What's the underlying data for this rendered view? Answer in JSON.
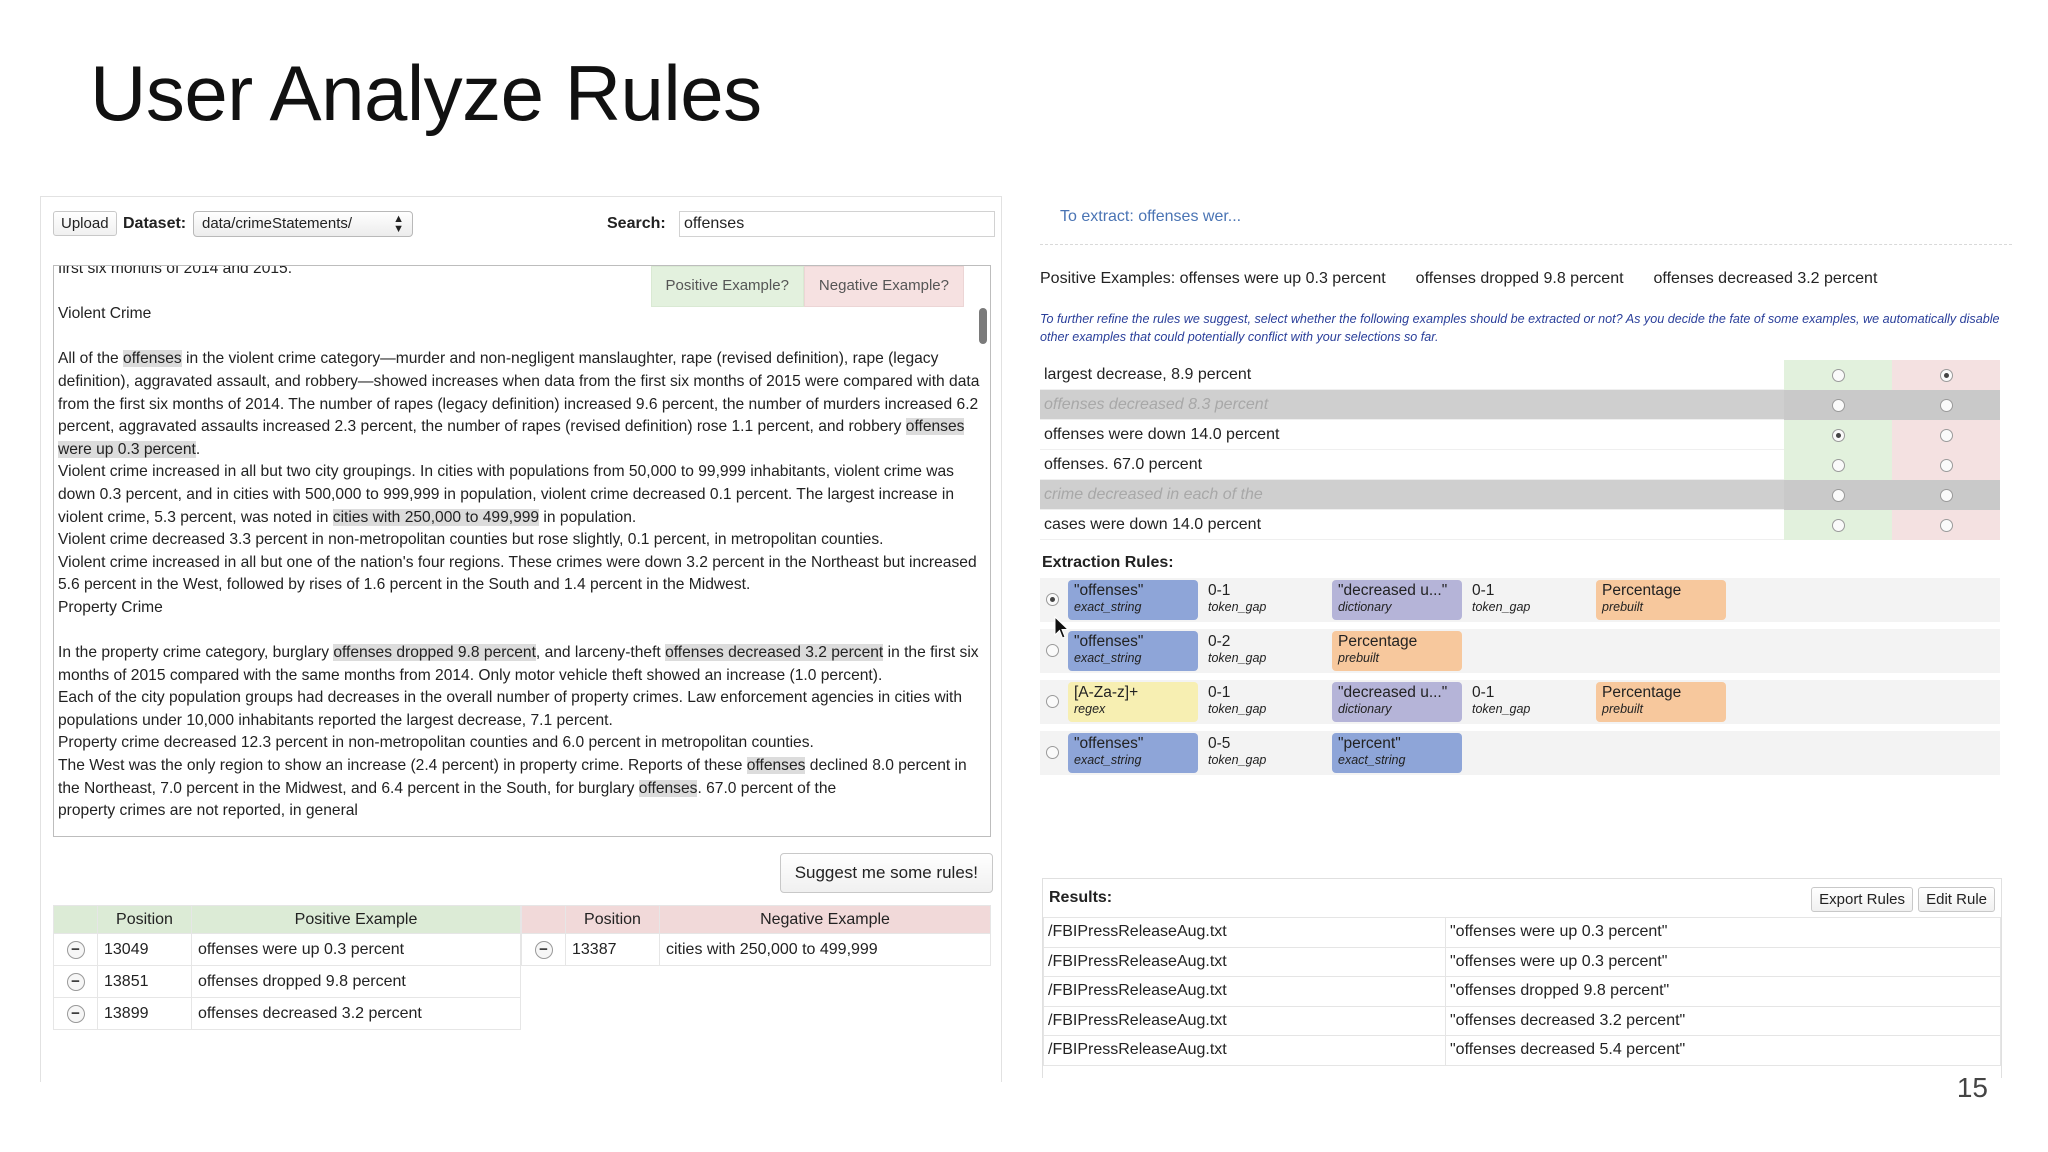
{
  "slide": {
    "title": "User Analyze Rules",
    "page_number": "15"
  },
  "left": {
    "toolbar": {
      "upload_label": "Upload",
      "dataset_label": "Dataset:",
      "dataset_value": "data/crimeStatements/",
      "search_label": "Search:",
      "search_value": "offenses"
    },
    "example_tabs": {
      "positive": "Positive Example?",
      "negative": "Negative Example?"
    },
    "text": {
      "l0": "first six months of 2014 and 2015.",
      "heading1": "Violent Crime",
      "p1_a": "All of the ",
      "p1_h1": "offenses",
      "p1_b": " in the violent crime category—murder and non-negligent manslaughter, rape (revised definition), rape (legacy definition), aggravated assault, and robbery—showed increases when data from the first six months of 2015 were compared with data from the first six months of 2014. The number of rapes (legacy definition) increased 9.6 percent, the number of murders increased 6.2 percent, aggravated assaults increased 2.3 percent, the number of rapes (revised definition) rose 1.1 percent, and robbery ",
      "p1_h2": "offenses were up 0.3 percent",
      "p1_c": ".",
      "p2_a": "Violent crime increased in all but two city groupings. In cities with populations from 50,000 to 99,999 inhabitants, violent crime was down 0.3 percent, and in cities with 500,000 to 999,999 in population, violent crime decreased 0.1 percent. The largest increase in violent crime, 5.3 percent, was noted in ",
      "p2_h": "cities with 250,000 to 499,999",
      "p2_b": " in population.",
      "p3": "Violent crime decreased 3.3 percent in non-metropolitan counties but rose slightly, 0.1 percent, in metropolitan counties.",
      "p4": "Violent crime increased in all but one of the nation's four regions. These crimes were down 3.2 percent in the Northeast but increased 5.6 percent in the West, followed by rises of 1.6 percent in the South and 1.4 percent in the Midwest.",
      "heading2": "Property Crime",
      "p5_a": "In the property crime category, burglary ",
      "p5_h1": "offenses dropped 9.8 percent",
      "p5_b": ", and larceny-theft ",
      "p5_h2": "offenses decreased 3.2 percent",
      "p5_c": " in the first six months of 2015 compared with the same months from 2014. Only motor vehicle theft showed an increase (1.0 percent).",
      "p6": "Each of the city population groups had decreases in the overall number of property crimes. Law enforcement agencies in cities with populations under 10,000 inhabitants reported the largest decrease, 7.1 percent.",
      "p7": "Property crime decreased 12.3 percent in non-metropolitan counties and 6.0 percent in metropolitan counties.",
      "p8_a": "The West was the only region to show an increase (2.4 percent) in property crime. Reports of these ",
      "p8_h1": "offenses",
      "p8_b": " declined 8.0 percent in the Northeast, 7.0 percent in the Midwest, and 6.4 percent in the South, for burglary ",
      "p8_h2": "offenses",
      "p8_c": ". 67.0 percent of the",
      "p9": "property crimes are not reported, in general"
    },
    "suggest_label": "Suggest me some rules!",
    "positive_table": {
      "headers": [
        "Position",
        "Positive Example"
      ],
      "rows": [
        {
          "position": "13049",
          "example": "offenses were up 0.3 percent"
        },
        {
          "position": "13851",
          "example": "offenses dropped 9.8 percent"
        },
        {
          "position": "13899",
          "example": "offenses decreased 3.2 percent"
        }
      ]
    },
    "negative_table": {
      "headers": [
        "Position",
        "Negative Example"
      ],
      "rows": [
        {
          "position": "13387",
          "example": "cities with 250,000 to 499,999"
        }
      ]
    }
  },
  "right": {
    "extract_title": "To extract: offenses wer...",
    "positive_examples_label": "Positive Examples: offenses were up 0.3 percent",
    "positive_examples_2": "offenses dropped 9.8 percent",
    "positive_examples_3": "offenses decreased 3.2 percent",
    "instructions": "To further refine the rules we suggest, select whether the following examples should be extracted or not? As you decide the fate of some examples, we automatically disable other examples that could potentially conflict with your selections so far.",
    "candidates": [
      {
        "text": "largest decrease, 8.9 percent",
        "disabled": false,
        "selected": "negative"
      },
      {
        "text": "offenses decreased 8.3 percent",
        "disabled": true,
        "selected": "none"
      },
      {
        "text": "offenses were down 14.0 percent",
        "disabled": false,
        "selected": "positive"
      },
      {
        "text": "offenses. 67.0 percent",
        "disabled": false,
        "selected": "none"
      },
      {
        "text": "crime decreased in each of the",
        "disabled": true,
        "selected": "none"
      },
      {
        "text": "cases were down 14.0 percent",
        "disabled": false,
        "selected": "none"
      }
    ],
    "rules_label": "Extraction Rules:",
    "rules": [
      {
        "selected": true,
        "c1": "\"offenses\"",
        "c1s": "exact_string",
        "g1": "0-1",
        "g1s": "token_gap",
        "c2": "\"decreased u...\"",
        "c2s": "dictionary",
        "g2": "0-1",
        "g2s": "token_gap",
        "c3": "Percentage",
        "c3s": "prebuilt"
      },
      {
        "selected": false,
        "c1": "\"offenses\"",
        "c1s": "exact_string",
        "g1": "0-2",
        "g1s": "token_gap",
        "c2": "Percentage",
        "c2s": "prebuilt"
      },
      {
        "selected": false,
        "c1": "[A-Za-z]+",
        "c1s": "regex",
        "g1": "0-1",
        "g1s": "token_gap",
        "c2": "\"decreased u...\"",
        "c2s": "dictionary",
        "g2": "0-1",
        "g2s": "token_gap",
        "c3": "Percentage",
        "c3s": "prebuilt"
      },
      {
        "selected": false,
        "c1": "\"offenses\"",
        "c1s": "exact_string",
        "g1": "0-5",
        "g1s": "token_gap",
        "c2": "\"percent\"",
        "c2s": "exact_string"
      }
    ],
    "results_label": "Results:",
    "export_label": "Export Rules",
    "edit_label": "Edit Rule",
    "results": [
      {
        "file": "/FBIPressReleaseAug.txt",
        "match": "\"offenses were up 0.3 percent\""
      },
      {
        "file": "/FBIPressReleaseAug.txt",
        "match": "\"offenses were up 0.3 percent\""
      },
      {
        "file": "/FBIPressReleaseAug.txt",
        "match": "\"offenses dropped 9.8 percent\""
      },
      {
        "file": "/FBIPressReleaseAug.txt",
        "match": "\"offenses decreased 3.2 percent\""
      },
      {
        "file": "/FBIPressReleaseAug.txt",
        "match": "\"offenses decreased 5.4 percent\""
      }
    ]
  }
}
